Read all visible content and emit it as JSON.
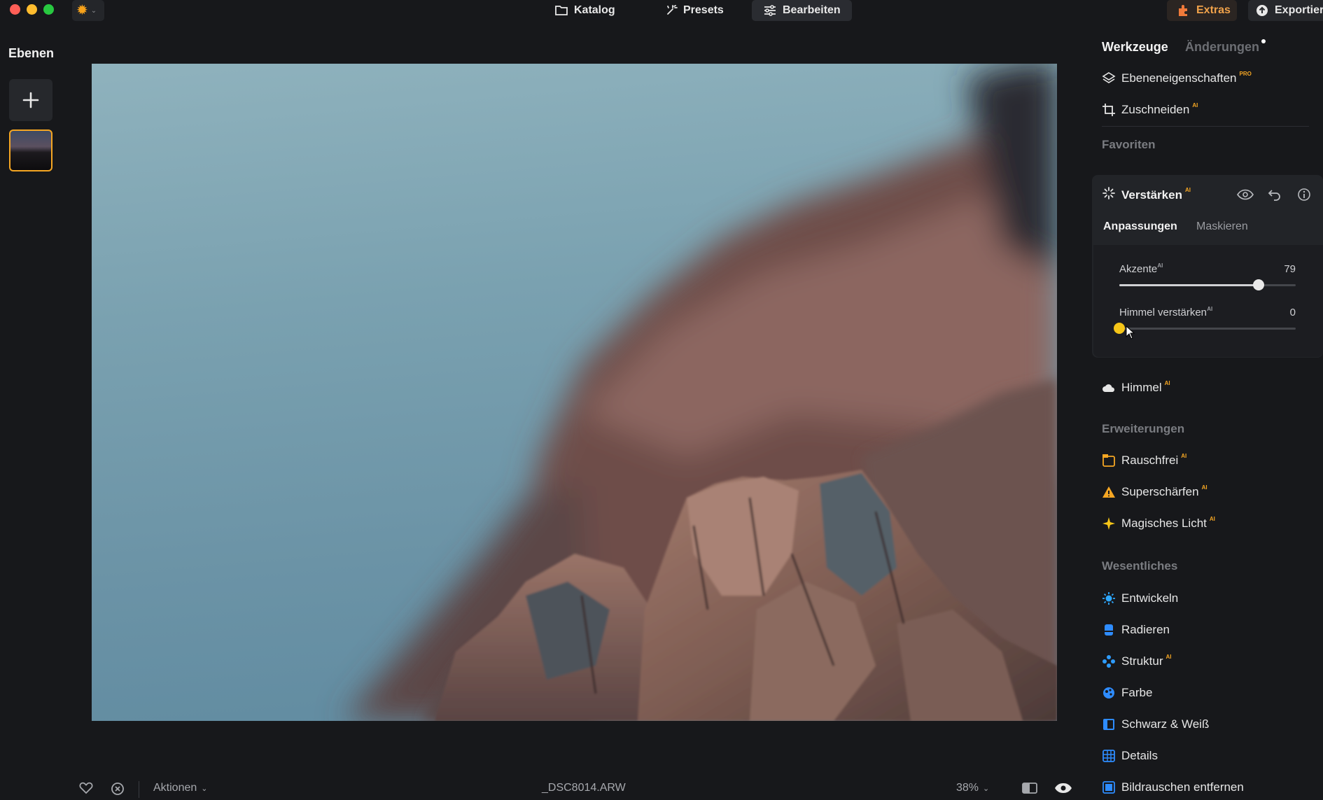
{
  "topbar": {
    "nav": [
      {
        "label": "Katalog",
        "icon": "folder-icon"
      },
      {
        "label": "Presets",
        "icon": "sparkle-icon"
      },
      {
        "label": "Bearbeiten",
        "icon": "sliders-icon"
      }
    ],
    "extras_label": "Extras",
    "export_label": "Exportiere"
  },
  "layers": {
    "title": "Ebenen"
  },
  "bottombar": {
    "actions_label": "Aktionen",
    "filename": "_DSC8014.ARW",
    "zoom": "38%"
  },
  "right_panel": {
    "tabs": [
      "Werkzeuge",
      "Änderungen"
    ],
    "top_tools": [
      {
        "label": "Ebeneneigenschaften",
        "badge": "PRO"
      },
      {
        "label": "Zuschneiden",
        "badge": "AI"
      }
    ],
    "favorites_label": "Favoriten",
    "enhance": {
      "title": "Verstärken",
      "badge": "AI",
      "subtabs": [
        "Anpassungen",
        "Maskieren"
      ],
      "sliders": [
        {
          "label": "Akzente",
          "badge": "AI",
          "value": "79",
          "fraction": 0.79
        },
        {
          "label": "Himmel verstärken",
          "badge": "AI",
          "value": "0",
          "fraction": 0.0
        }
      ]
    },
    "sky": {
      "label": "Himmel",
      "badge": "AI"
    },
    "extensions_label": "Erweiterungen",
    "extensions": [
      {
        "label": "Rauschfrei",
        "badge": "AI"
      },
      {
        "label": "Superschärfen",
        "badge": "AI"
      },
      {
        "label": "Magisches Licht",
        "badge": "AI"
      }
    ],
    "essentials_label": "Wesentliches",
    "essentials": [
      {
        "label": "Entwickeln"
      },
      {
        "label": "Radieren"
      },
      {
        "label": "Struktur",
        "badge": "AI"
      },
      {
        "label": "Farbe"
      },
      {
        "label": "Schwarz & Weiß"
      },
      {
        "label": "Details"
      },
      {
        "label": "Bildrauschen entfernen"
      }
    ]
  },
  "colors": {
    "accent": "#f5a623",
    "background": "#17181b",
    "panel": "#222428"
  }
}
